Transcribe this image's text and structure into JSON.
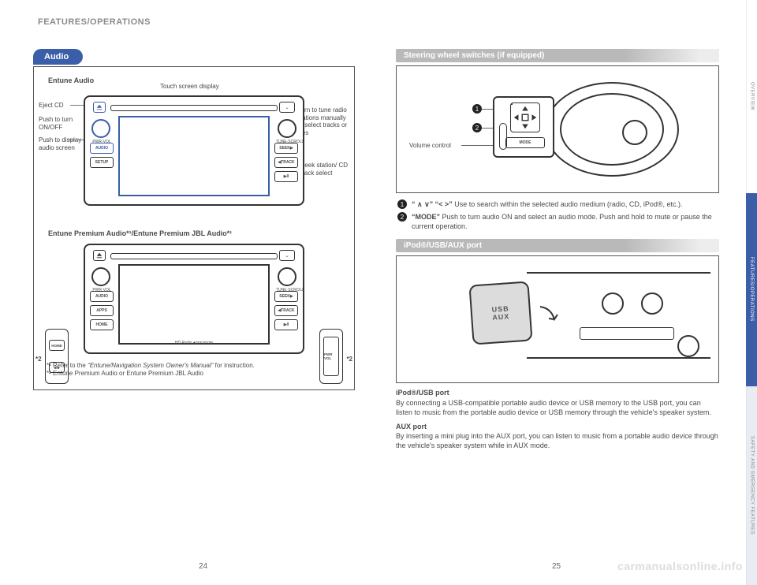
{
  "header": "FEATURES/OPERATIONS",
  "side_tabs": {
    "t1": "OVERVIEW",
    "t2": "FEATURES/OPERATIONS",
    "t3": "SAFETY AND EMERGENCY FEATURES"
  },
  "left": {
    "pill": "Audio",
    "unit1": {
      "title": "Entune Audio",
      "callouts": {
        "top": "Touch screen display",
        "eject": "Eject CD",
        "power": "Push to turn ON/OFF",
        "audio": "Push to display audio screen",
        "tune": "Turn to tune radio stations manually or select tracks or files",
        "seek": "Seek station/ CD track select"
      },
      "btns_left": [
        "AUDIO",
        "SETUP"
      ],
      "btns_right": [
        "SEEK▶",
        "◀TRACK",
        "▶II"
      ],
      "knob_l_label": "PWR·VOL",
      "knob_r_label": "TUNE·SCROLL"
    },
    "unit2": {
      "title": "Entune Premium Audio*¹/Entune Premium JBL Audio*¹",
      "btns_left": [
        "AUDIO",
        "APPS",
        "HOME"
      ],
      "btns_right": [
        "SEEK▶",
        "◀TRACK",
        "▶II"
      ],
      "side_left": [
        "HOME",
        "■/■"
      ],
      "side_right": [
        "PWR\nVOL"
      ],
      "hd": "HD Radio    ●gracenote",
      "ast2": "*2"
    },
    "footnotes": {
      "f1_a": "*¹ Refer to the ",
      "f1_i": "“Entune/Navigation System Owner's Manual”",
      "f1_b": " for instruction.",
      "f2": "*² Entune Premium Audio or Entune Premium JBL Audio"
    }
  },
  "right": {
    "sec1": {
      "bar": "Steering wheel switches (if equipped)",
      "vol_label": "Volume control",
      "mode_label": "MODE",
      "num1": "1",
      "num2": "2",
      "items": [
        {
          "num": "1",
          "head": "“ ∧  ∨”  “<   >”",
          "body": "Use to search within the selected audio medium (radio, CD, iPod®, etc.)."
        },
        {
          "num": "2",
          "head": "“MODE”",
          "body": "Push to turn audio ON and select an audio mode. Push and hold to mute or pause the current operation."
        }
      ]
    },
    "sec2": {
      "bar": "iPod®/USB/AUX port",
      "usb_label1": "USB",
      "usb_label2": "AUX",
      "p1_head": "iPod®/USB port",
      "p1_body": "By connecting a USB-compatible portable audio device or USB memory to the USB port, you can listen to music from the portable audio device or USB memory through the vehicle's speaker system.",
      "p2_head": "AUX port",
      "p2_body": "By inserting a mini plug into the AUX port, you can listen to music from a portable audio device through the vehicle's speaker system while in AUX mode."
    }
  },
  "pages": {
    "left": "24",
    "right": "25"
  },
  "watermark": "carmanualsonline.info"
}
